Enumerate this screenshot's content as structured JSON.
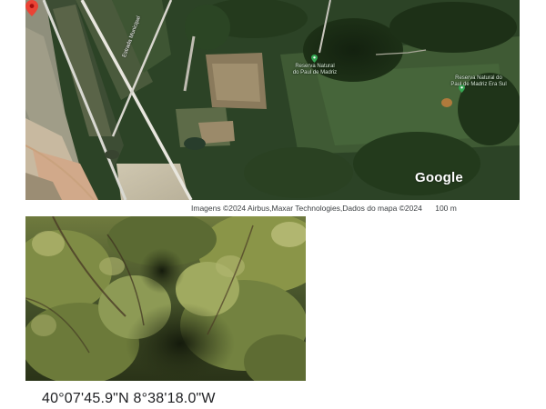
{
  "map": {
    "places": [
      {
        "label": "Reserva Natural\ndo Paul de Madriz"
      },
      {
        "label": "Reserva Natural do\nPaul de Madriz Era Sul"
      }
    ],
    "road_label": "Estrada Municipal",
    "logo_text": "Google",
    "attribution": "Imagens ©2024 Airbus,Maxar Technologies,Dados do mapa ©2024",
    "scale_label": "100 m",
    "colors": {
      "place_pin": "#34a853",
      "selected_pin": "#ea4335"
    }
  },
  "photo": {
    "description_icon": "vegetation-photo"
  },
  "coordinates": "40°07'45.9\"N 8°38'18.0\"W"
}
